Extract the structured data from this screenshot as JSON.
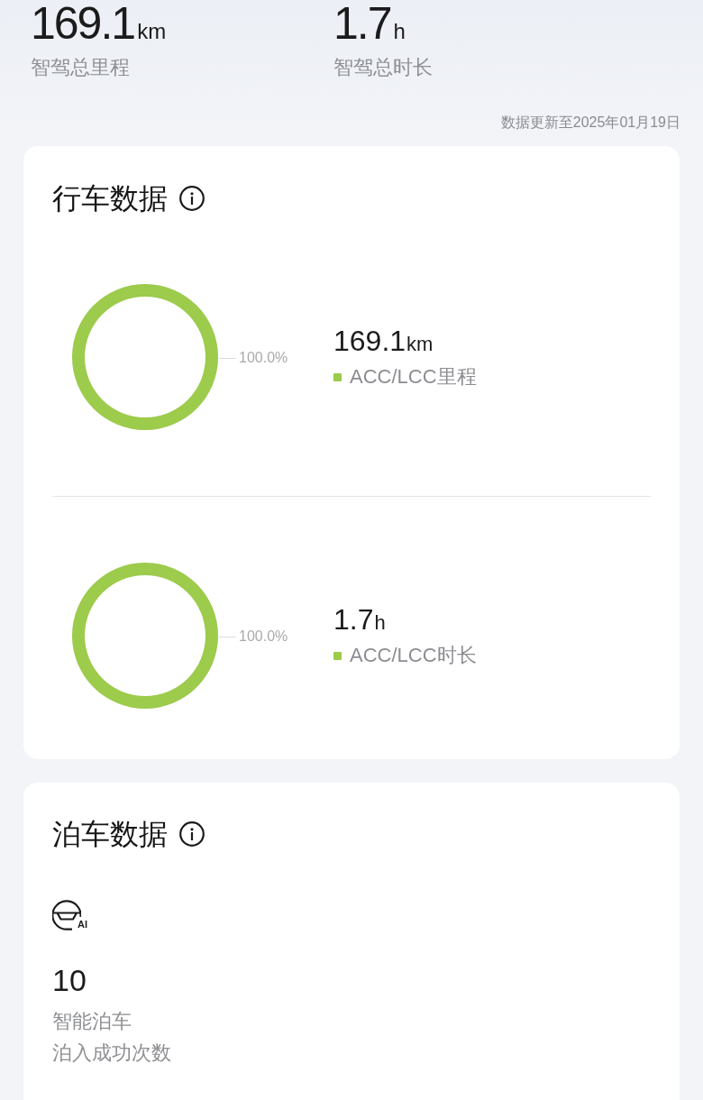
{
  "summary": [
    {
      "value": "169.1",
      "unit": "km",
      "label": "智驾总里程"
    },
    {
      "value": "1.7",
      "unit": "h",
      "label": "智驾总时长"
    }
  ],
  "update_note": "数据更新至2025年01月19日",
  "driving": {
    "title": "行车数据",
    "metrics": [
      {
        "value": "169.1",
        "unit": "km",
        "ring": {
          "level": 1.0,
          "label": "100.0%"
        },
        "legend": {
          "label": "ACC/LCC里程",
          "color": "#9dcb4b"
        }
      },
      {
        "value": "1.7",
        "unit": "h",
        "ring": {
          "level": 1.0,
          "label": "100.0%"
        },
        "legend": {
          "label": "ACC/LCC时长",
          "color": "#9dcb4b"
        }
      }
    ]
  },
  "parking": {
    "title": "泊车数据",
    "icon_badge": "AI",
    "stats": [
      {
        "value": "10",
        "name": "智能泊车",
        "caption": "泊入成功次数"
      }
    ]
  }
}
